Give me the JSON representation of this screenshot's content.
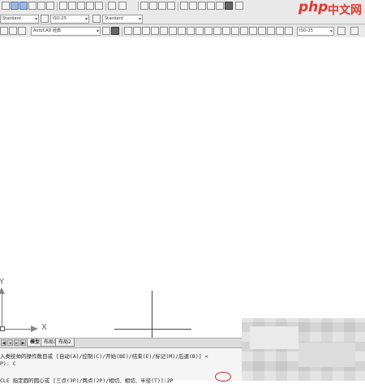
{
  "toolbar": {
    "style_select": "Standard",
    "dim_select": "ISO-25",
    "table_select": "Standard",
    "workspace_select": "AutoCAD 经典",
    "layer_select": "ISO-25"
  },
  "logo": {
    "php": "php",
    "cn": "中文网"
  },
  "canvas": {
    "ucs_y_label": "Y",
    "ucs_x_label": "X"
  },
  "tabs": {
    "nav_first": "◀",
    "nav_prev": "◂",
    "nav_next": "▸",
    "nav_last": "▶",
    "model": "模型",
    "layout1": "布局1",
    "layout2": "布局2"
  },
  "command": {
    "line1": "入类统帅的操作数目或 [自动(A)/控制(C)/开始(BE)/结束(E)/标记(M)/后退(B)] <",
    "line2": "P): C",
    "prompt": "CLE 指定圆的圆心或 [三点(3P)/两点(2P)/相切、相切、半径(T)]:",
    "input": "2P"
  },
  "colors": {
    "accent_red": "#cc2a2a",
    "logo_red": "#e0372f"
  }
}
